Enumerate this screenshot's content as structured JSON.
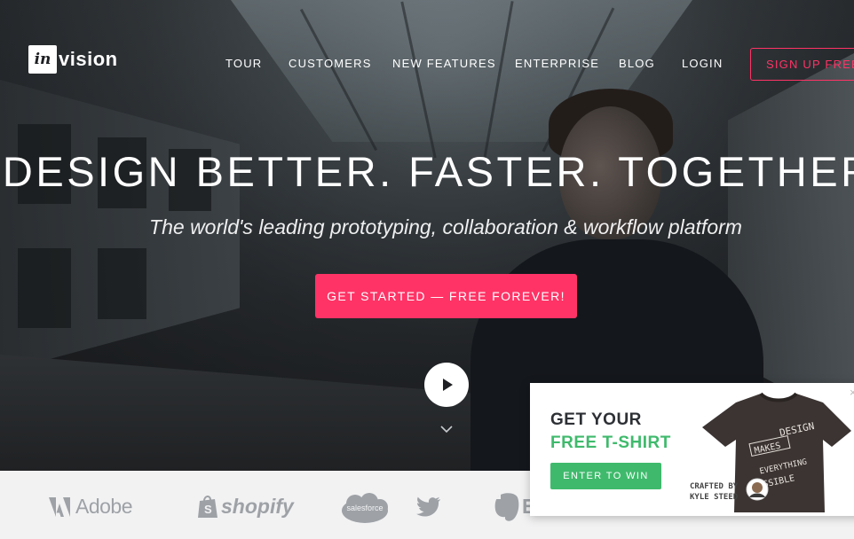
{
  "brand": {
    "logo_box": "in",
    "logo_text": "vision"
  },
  "nav": {
    "items": [
      "TOUR",
      "CUSTOMERS",
      "NEW FEATURES",
      "ENTERPRISE",
      "BLOG",
      "LOGIN"
    ],
    "signup": "SIGN UP FREE"
  },
  "hero": {
    "headline": "DESIGN BETTER. FASTER. TOGETHER.",
    "subheadline": "The world's leading prototyping, collaboration & workflow platform",
    "cta": "GET STARTED — FREE FOREVER!"
  },
  "customers": {
    "logos": [
      "Adobe",
      "shopify",
      "salesforce",
      "twitter",
      "E"
    ]
  },
  "promo": {
    "line1": "GET YOUR",
    "line2": "FREE T-SHIRT",
    "button": "ENTER TO WIN",
    "credit_line1": "CRAFTED BY",
    "credit_line2": "KYLE STEED",
    "shirt_words": [
      "DESIGN",
      "MAKES",
      "EVERYTHING",
      "POSSIBLE"
    ]
  },
  "colors": {
    "accent_pink": "#ff3366",
    "accent_green": "#3fba6c",
    "logo_gray": "#9ea2a7"
  }
}
